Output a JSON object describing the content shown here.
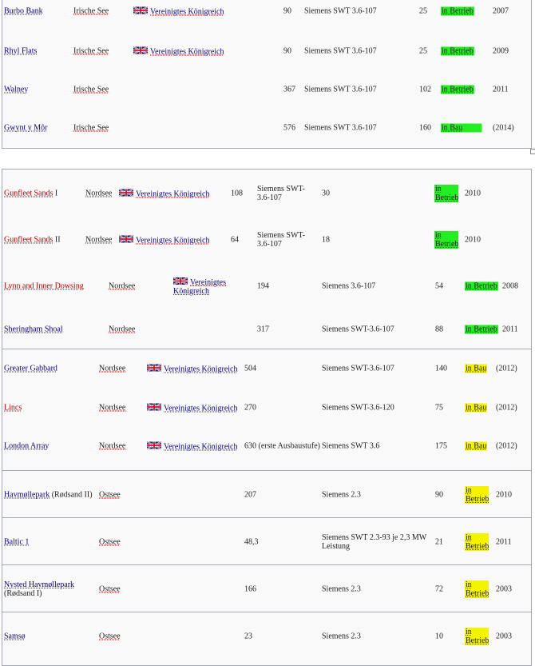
{
  "colors": {
    "in_operation": "#22ee22",
    "under_construction": "#f4f400",
    "border": "#a2a9b1",
    "row_bg": "#f9f9f9"
  },
  "table1": [
    {
      "name": "Burbo Bank",
      "sea": "Irische See",
      "country": "Vereinigtes Königreich",
      "mw": "90",
      "turbine": "Siemens SWT 3.6-107",
      "count": "25",
      "status": "in Betrieb",
      "year": "2007"
    },
    {
      "name": "Rhyl Flats",
      "sea": "Irische See",
      "country": "Vereinigtes Königreich",
      "mw": "90",
      "turbine": "Siemens SWT 3.6-107",
      "count": "25",
      "status": "in Betrieb",
      "year": "2009"
    },
    {
      "name": "Walney",
      "sea": "Irische See",
      "mw": "367",
      "turbine": "Siemens SWT 3.6-107",
      "count": "102",
      "status": "in Betrieb",
      "year": "2011"
    },
    {
      "name": "Gwynt y Môr",
      "sea": "Irische See",
      "mw": "576",
      "turbine": "Siemens SWT 3.6-107",
      "count": "160",
      "status": "in Bau",
      "year": "(2014)"
    }
  ],
  "table2": {
    "gunfleet1": {
      "name": "Gunfleet Sands",
      "suffix": " I",
      "sea": "Nordsee",
      "country": "Vereinigtes Königreich",
      "mw": "108",
      "turbine": "Siemens SWT-3.6-107",
      "count": "30",
      "status": "in Betrieb",
      "year": "2010"
    },
    "gunfleet2": {
      "name": "Gunfleet Sands",
      "suffix": " II",
      "sea": "Nordsee",
      "country": "Vereinigtes Königreich",
      "mw": "64",
      "turbine": "Siemens SWT-3.6-107",
      "count": "18",
      "status": "in Betrieb",
      "year": "2010"
    },
    "lynn": {
      "name": "Lynn and Inner Dowsing",
      "sea": "Nordsee",
      "country": "Vereinigtes Königreich",
      "mw": "194",
      "turbine": "Siemens 3.6-107",
      "count": "54",
      "status": "in Betrieb",
      "year": "2008"
    },
    "sheringham": {
      "name": "Sheringham Shoal",
      "sea": "Nordsee",
      "mw": "317",
      "turbine": "Siemens SWT-3.6-107",
      "count": "88",
      "status": "in Betrieb",
      "year": "2011"
    },
    "gabbard": {
      "name": "Greater Gabbard",
      "sea": "Nordsee",
      "country": "Vereinigtes Königreich",
      "mw": "504",
      "turbine": "Siemens SWT-3.6-107",
      "count": "140",
      "status": "in Bau",
      "year": "(2012)"
    },
    "lincs": {
      "name": "Lincs",
      "sea": "Nordsee",
      "country": "Vereinigtes Königreich",
      "mw": "270",
      "turbine": "Siemens SWT-3.6-120",
      "count": "75",
      "status": "in Bau",
      "year": "(2012)"
    },
    "london": {
      "name": "London Array",
      "sea": "Nordsee",
      "country": "Vereinigtes Königreich",
      "mw": "630 (erste Ausbaustufe)",
      "turbine": "Siemens SWT 3.6",
      "count": "175",
      "status": "in Bau",
      "year": "(2012)"
    },
    "rodsand2": {
      "name": "Havmøllepark",
      "suffix": " (Rødsand II)",
      "sea": "Ostsee",
      "mw": "207",
      "turbine": "Siemens 2.3",
      "count": "90",
      "status": "in Betrieb",
      "year": "2010"
    },
    "baltic1": {
      "name": "Baltic 1",
      "sea": "Ostsee",
      "mw": "48,3",
      "turbine": "Siemens SWT 2.3-93 je 2,3 MW Leistung",
      "count": "21",
      "status": "in Betrieb",
      "year": "2011"
    },
    "nysted": {
      "name": "Nysted Havmøllepark",
      "suffix": " (Rødsand I)",
      "sea": "Ostsee",
      "mw": "166",
      "turbine": "Siemens 2.3",
      "count": "72",
      "status": "in Betrieb",
      "year": "2003"
    },
    "samso": {
      "name": "Samsø",
      "sea": "Ostsee",
      "mw": "23",
      "turbine": "Siemens 2.3",
      "count": "10",
      "status": "in Betrieb",
      "year": "2003"
    }
  }
}
